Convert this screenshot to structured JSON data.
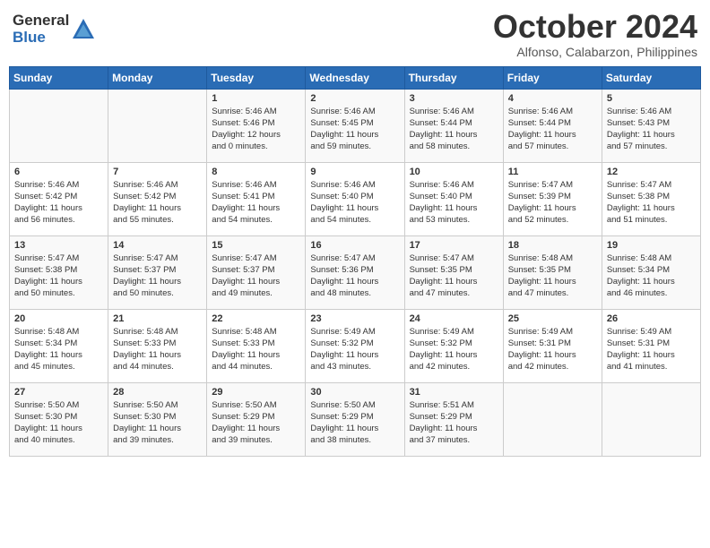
{
  "logo": {
    "general": "General",
    "blue": "Blue"
  },
  "title": "October 2024",
  "subtitle": "Alfonso, Calabarzon, Philippines",
  "headers": [
    "Sunday",
    "Monday",
    "Tuesday",
    "Wednesday",
    "Thursday",
    "Friday",
    "Saturday"
  ],
  "weeks": [
    [
      {
        "day": "",
        "info": ""
      },
      {
        "day": "",
        "info": ""
      },
      {
        "day": "1",
        "info": "Sunrise: 5:46 AM\nSunset: 5:46 PM\nDaylight: 12 hours\nand 0 minutes."
      },
      {
        "day": "2",
        "info": "Sunrise: 5:46 AM\nSunset: 5:45 PM\nDaylight: 11 hours\nand 59 minutes."
      },
      {
        "day": "3",
        "info": "Sunrise: 5:46 AM\nSunset: 5:44 PM\nDaylight: 11 hours\nand 58 minutes."
      },
      {
        "day": "4",
        "info": "Sunrise: 5:46 AM\nSunset: 5:44 PM\nDaylight: 11 hours\nand 57 minutes."
      },
      {
        "day": "5",
        "info": "Sunrise: 5:46 AM\nSunset: 5:43 PM\nDaylight: 11 hours\nand 57 minutes."
      }
    ],
    [
      {
        "day": "6",
        "info": "Sunrise: 5:46 AM\nSunset: 5:42 PM\nDaylight: 11 hours\nand 56 minutes."
      },
      {
        "day": "7",
        "info": "Sunrise: 5:46 AM\nSunset: 5:42 PM\nDaylight: 11 hours\nand 55 minutes."
      },
      {
        "day": "8",
        "info": "Sunrise: 5:46 AM\nSunset: 5:41 PM\nDaylight: 11 hours\nand 54 minutes."
      },
      {
        "day": "9",
        "info": "Sunrise: 5:46 AM\nSunset: 5:40 PM\nDaylight: 11 hours\nand 54 minutes."
      },
      {
        "day": "10",
        "info": "Sunrise: 5:46 AM\nSunset: 5:40 PM\nDaylight: 11 hours\nand 53 minutes."
      },
      {
        "day": "11",
        "info": "Sunrise: 5:47 AM\nSunset: 5:39 PM\nDaylight: 11 hours\nand 52 minutes."
      },
      {
        "day": "12",
        "info": "Sunrise: 5:47 AM\nSunset: 5:38 PM\nDaylight: 11 hours\nand 51 minutes."
      }
    ],
    [
      {
        "day": "13",
        "info": "Sunrise: 5:47 AM\nSunset: 5:38 PM\nDaylight: 11 hours\nand 50 minutes."
      },
      {
        "day": "14",
        "info": "Sunrise: 5:47 AM\nSunset: 5:37 PM\nDaylight: 11 hours\nand 50 minutes."
      },
      {
        "day": "15",
        "info": "Sunrise: 5:47 AM\nSunset: 5:37 PM\nDaylight: 11 hours\nand 49 minutes."
      },
      {
        "day": "16",
        "info": "Sunrise: 5:47 AM\nSunset: 5:36 PM\nDaylight: 11 hours\nand 48 minutes."
      },
      {
        "day": "17",
        "info": "Sunrise: 5:47 AM\nSunset: 5:35 PM\nDaylight: 11 hours\nand 47 minutes."
      },
      {
        "day": "18",
        "info": "Sunrise: 5:48 AM\nSunset: 5:35 PM\nDaylight: 11 hours\nand 47 minutes."
      },
      {
        "day": "19",
        "info": "Sunrise: 5:48 AM\nSunset: 5:34 PM\nDaylight: 11 hours\nand 46 minutes."
      }
    ],
    [
      {
        "day": "20",
        "info": "Sunrise: 5:48 AM\nSunset: 5:34 PM\nDaylight: 11 hours\nand 45 minutes."
      },
      {
        "day": "21",
        "info": "Sunrise: 5:48 AM\nSunset: 5:33 PM\nDaylight: 11 hours\nand 44 minutes."
      },
      {
        "day": "22",
        "info": "Sunrise: 5:48 AM\nSunset: 5:33 PM\nDaylight: 11 hours\nand 44 minutes."
      },
      {
        "day": "23",
        "info": "Sunrise: 5:49 AM\nSunset: 5:32 PM\nDaylight: 11 hours\nand 43 minutes."
      },
      {
        "day": "24",
        "info": "Sunrise: 5:49 AM\nSunset: 5:32 PM\nDaylight: 11 hours\nand 42 minutes."
      },
      {
        "day": "25",
        "info": "Sunrise: 5:49 AM\nSunset: 5:31 PM\nDaylight: 11 hours\nand 42 minutes."
      },
      {
        "day": "26",
        "info": "Sunrise: 5:49 AM\nSunset: 5:31 PM\nDaylight: 11 hours\nand 41 minutes."
      }
    ],
    [
      {
        "day": "27",
        "info": "Sunrise: 5:50 AM\nSunset: 5:30 PM\nDaylight: 11 hours\nand 40 minutes."
      },
      {
        "day": "28",
        "info": "Sunrise: 5:50 AM\nSunset: 5:30 PM\nDaylight: 11 hours\nand 39 minutes."
      },
      {
        "day": "29",
        "info": "Sunrise: 5:50 AM\nSunset: 5:29 PM\nDaylight: 11 hours\nand 39 minutes."
      },
      {
        "day": "30",
        "info": "Sunrise: 5:50 AM\nSunset: 5:29 PM\nDaylight: 11 hours\nand 38 minutes."
      },
      {
        "day": "31",
        "info": "Sunrise: 5:51 AM\nSunset: 5:29 PM\nDaylight: 11 hours\nand 37 minutes."
      },
      {
        "day": "",
        "info": ""
      },
      {
        "day": "",
        "info": ""
      }
    ]
  ]
}
